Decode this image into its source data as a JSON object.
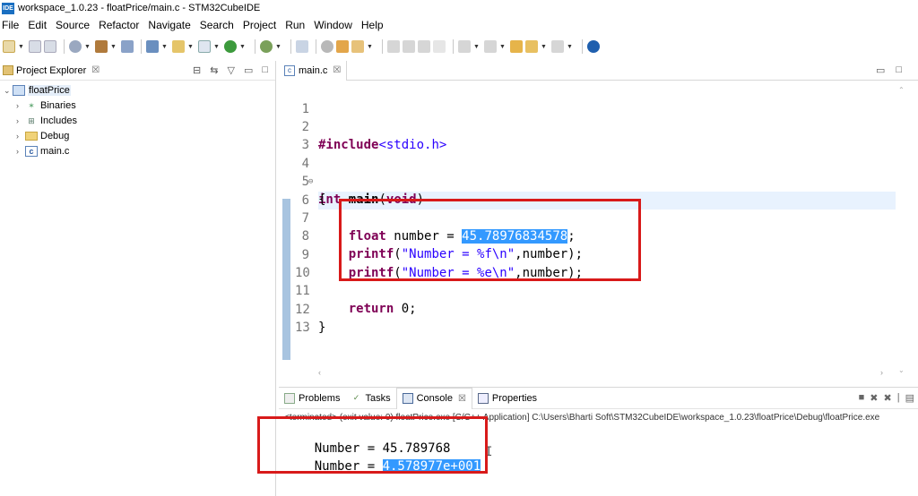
{
  "window": {
    "logo": "IDE",
    "title": "workspace_1.0.23 - floatPrice/main.c - STM32CubeIDE"
  },
  "menu": [
    "File",
    "Edit",
    "Source",
    "Refactor",
    "Navigate",
    "Search",
    "Project",
    "Run",
    "Window",
    "Help"
  ],
  "project_explorer": {
    "title": "Project Explorer",
    "close": "☒",
    "tree": [
      {
        "label": "floatPrice",
        "level": 0,
        "expanded": true,
        "icon": "project-icon"
      },
      {
        "label": "Binaries",
        "level": 1,
        "expanded": false,
        "icon": "binaries-icon"
      },
      {
        "label": "Includes",
        "level": 1,
        "expanded": false,
        "icon": "includes-icon"
      },
      {
        "label": "Debug",
        "level": 1,
        "expanded": false,
        "icon": "folder-icon"
      },
      {
        "label": "main.c",
        "level": 1,
        "expanded": false,
        "icon": "c-file-icon"
      }
    ]
  },
  "editor": {
    "tab_label": "main.c",
    "close": "☒",
    "lines": [
      {
        "no": "1",
        "text": ""
      },
      {
        "no": "2",
        "text": "#include<stdio.h>"
      },
      {
        "no": "3",
        "text": ""
      },
      {
        "no": "4",
        "text": "int main(void)"
      },
      {
        "no": "5",
        "text": "{"
      },
      {
        "no": "6",
        "text": ""
      },
      {
        "no": "7",
        "text": "    float number = 45.78976834578;"
      },
      {
        "no": "8",
        "text": "    printf(\"Number = %f\\n\",number);"
      },
      {
        "no": "9",
        "text": "    printf(\"Number = %e\\n\",number);"
      },
      {
        "no": "10",
        "text": ""
      },
      {
        "no": "11",
        "text": "    return 0;"
      },
      {
        "no": "12",
        "text": "}"
      },
      {
        "no": "13",
        "text": ""
      }
    ],
    "highlighted_value": "45.78976834578"
  },
  "bottom_panel": {
    "tabs": [
      {
        "label": "Problems",
        "active": false,
        "icon": "problems-icon"
      },
      {
        "label": "Tasks",
        "active": false,
        "icon": "tasks-icon"
      },
      {
        "label": "Console",
        "active": true,
        "icon": "console-icon"
      },
      {
        "label": "Properties",
        "active": false,
        "icon": "properties-icon"
      }
    ],
    "close": "☒",
    "terminated": "<terminated> (exit value: 0) floatPrice.exe [C/C++ Application] C:\\Users\\Bharti Soft\\STM32CubeIDE\\workspace_1.0.23\\floatPrice\\Debug\\floatPrice.exe",
    "console_lines": [
      {
        "prefix": "Number = ",
        "value": "45.789768",
        "highlighted": false
      },
      {
        "prefix": "Number = ",
        "value": "4.578977e+001",
        "highlighted": true
      }
    ]
  },
  "colors": {
    "keyword": "#7f0055",
    "string": "#2a00ff",
    "selection": "#3399ff",
    "annotation_box": "#d81a1a"
  }
}
